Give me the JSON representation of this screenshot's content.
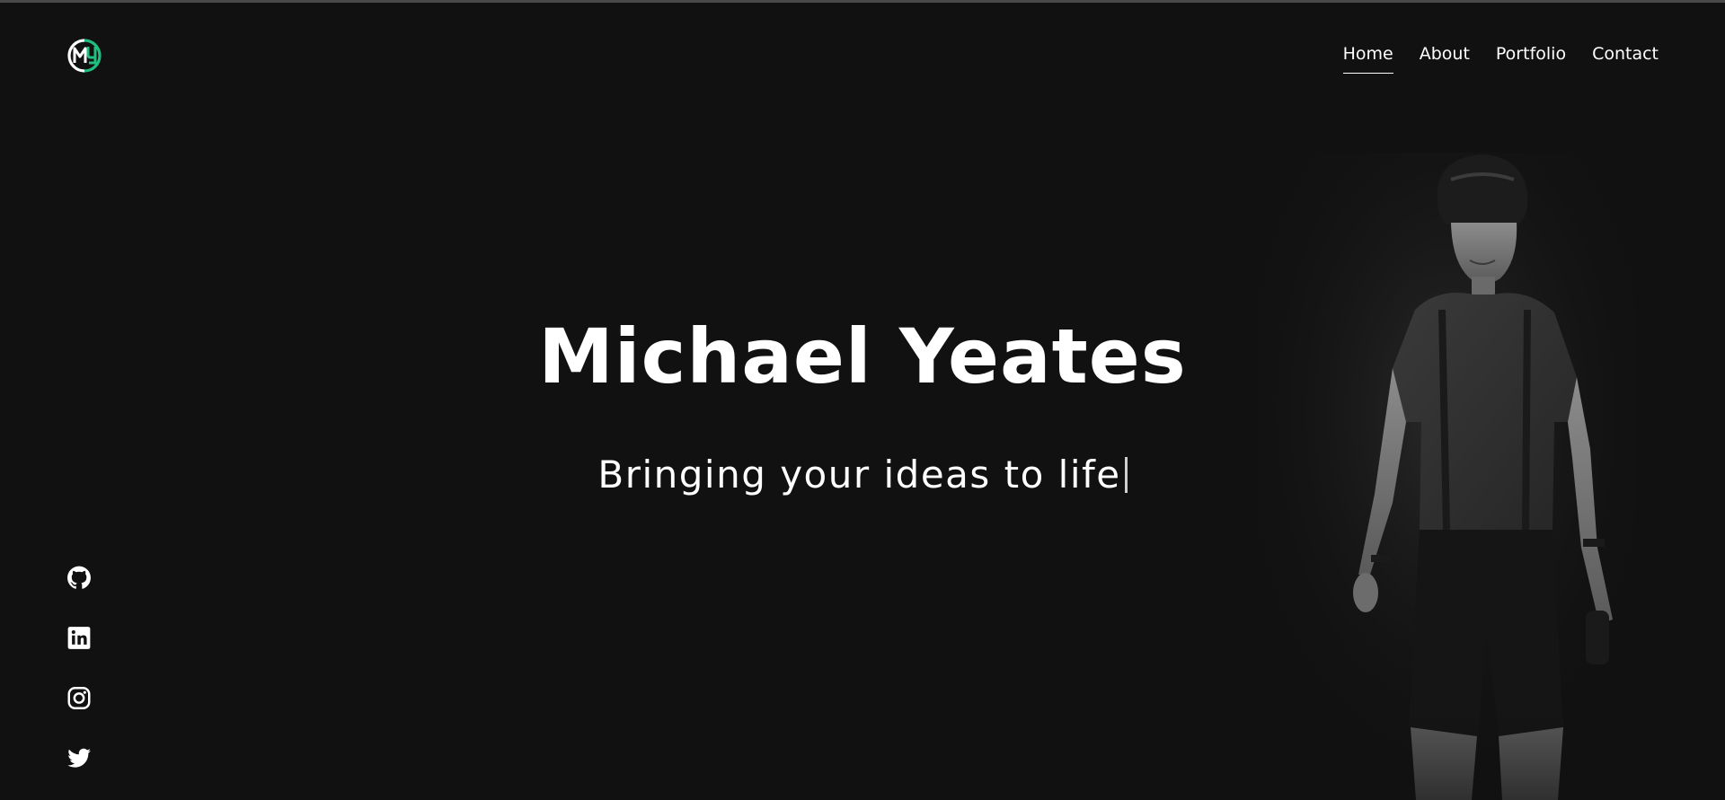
{
  "site": {
    "logo_icon": "my-monogram-logo",
    "accent_color": "#1fbf7f",
    "background_color": "#111111"
  },
  "nav": {
    "items": [
      {
        "label": "Home",
        "active": true
      },
      {
        "label": "About",
        "active": false
      },
      {
        "label": "Portfolio",
        "active": false
      },
      {
        "label": "Contact",
        "active": false
      }
    ]
  },
  "hero": {
    "title": "Michael Yeates",
    "subtitle": "Bringing your ideas to life"
  },
  "socials": [
    {
      "icon": "github-icon"
    },
    {
      "icon": "linkedin-icon"
    },
    {
      "icon": "instagram-icon"
    },
    {
      "icon": "twitter-icon"
    }
  ]
}
